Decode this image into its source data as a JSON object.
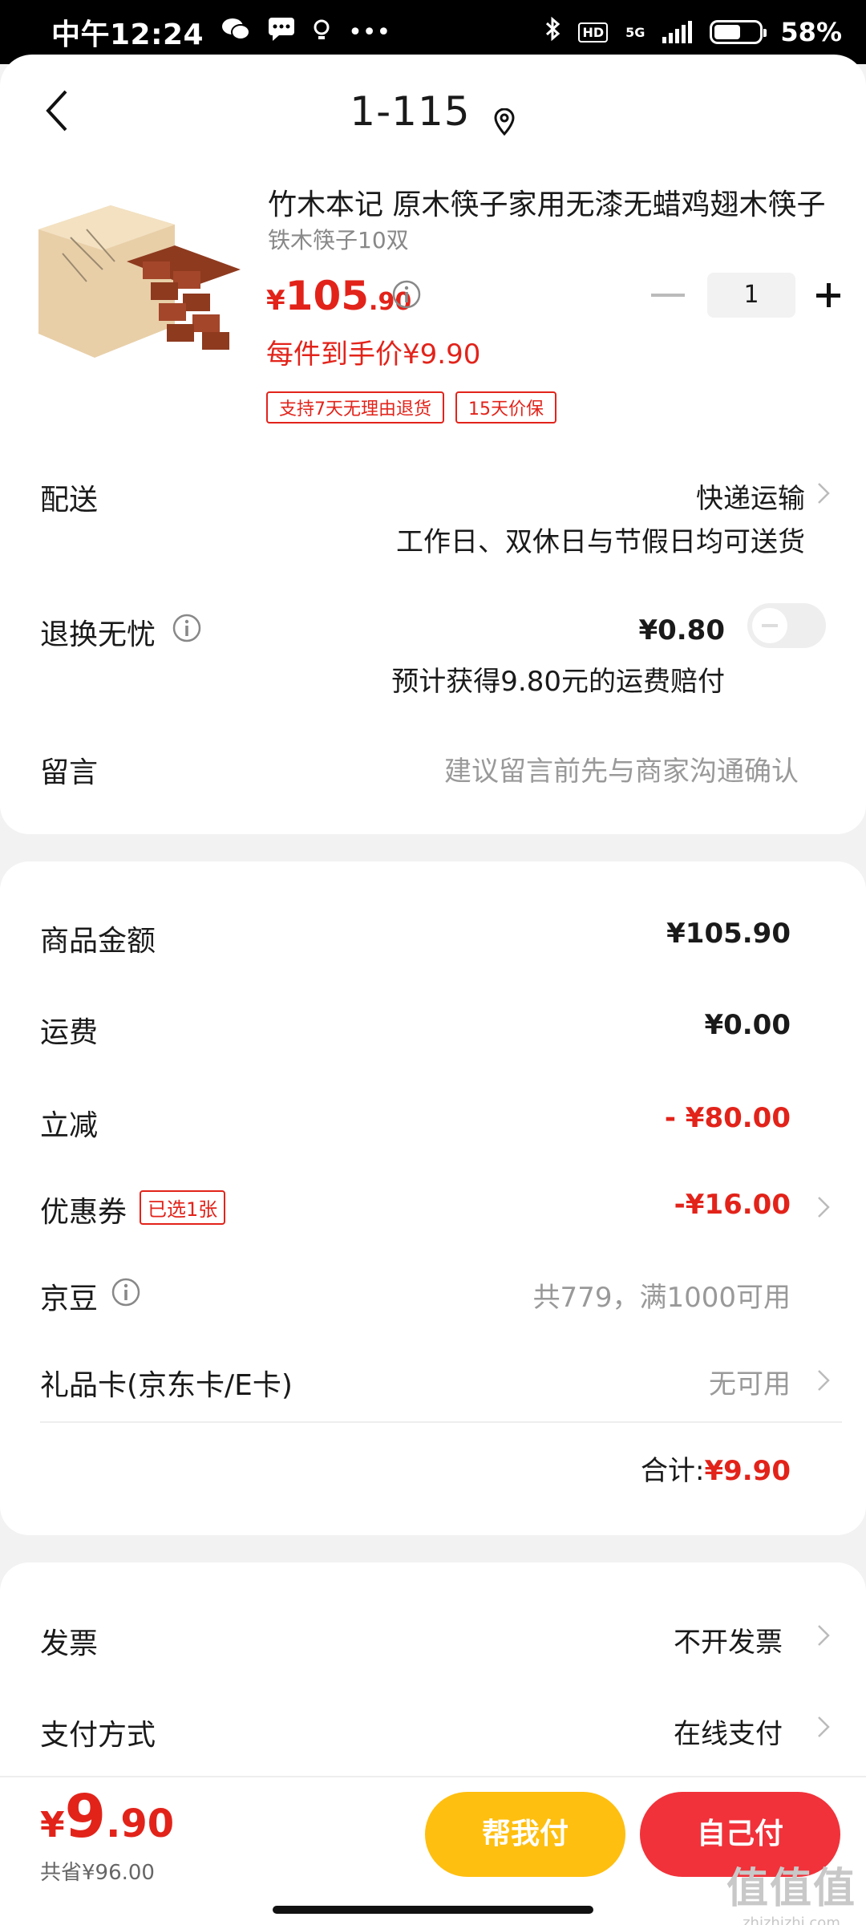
{
  "status_bar": {
    "time": "中午12:24",
    "network": "5G",
    "hd": "HD",
    "battery": "58%",
    "dots": "•••"
  },
  "header": {
    "title": "1-115"
  },
  "product": {
    "name": "竹木本记 原木筷子家用无漆无蜡鸡翅木筷子",
    "spec": "铁木筷子10双",
    "price_symbol": "¥",
    "price_int": "105",
    "price_dec": ".90",
    "per_item_price": "每件到手价¥9.90",
    "tags": [
      "支持7天无理由退货",
      "15天价保"
    ],
    "quantity": "1"
  },
  "delivery": {
    "label": "配送",
    "method": "快递运输",
    "note": "工作日、双休日与节假日均可送货"
  },
  "return_insurance": {
    "label": "退换无忧",
    "price": "¥0.80",
    "note": "预计获得9.80元的运费赔付"
  },
  "message": {
    "label": "留言",
    "placeholder": "建议留言前先与商家沟通确认"
  },
  "summary": {
    "goods_label": "商品金额",
    "goods_value": "¥105.90",
    "shipping_label": "运费",
    "shipping_value": "¥0.00",
    "discount_label": "立减",
    "discount_value": "- ¥80.00",
    "coupon_label": "优惠券",
    "coupon_badge": "已选1张",
    "coupon_value": "-¥16.00",
    "jingdou_label": "京豆",
    "jingdou_value": "共779，满1000可用",
    "giftcard_label": "礼品卡(京东卡/E卡)",
    "giftcard_value": "无可用",
    "total_label": "合计:",
    "total_value": "¥9.90"
  },
  "invoice": {
    "label": "发票",
    "value": "不开发票"
  },
  "payment": {
    "label": "支付方式",
    "value": "在线支付"
  },
  "bottom_bar": {
    "price_symbol": "¥",
    "price_int": "9",
    "price_dec": ".90",
    "saved": "共省¥96.00",
    "help_pay": "帮我付",
    "self_pay": "自己付"
  },
  "watermark": {
    "big": "值值值",
    "small": "zhizhizhi.com"
  },
  "colors": {
    "accent_red": "#e2231a",
    "help_button": "#ffbf10",
    "self_button": "#f1323a"
  }
}
